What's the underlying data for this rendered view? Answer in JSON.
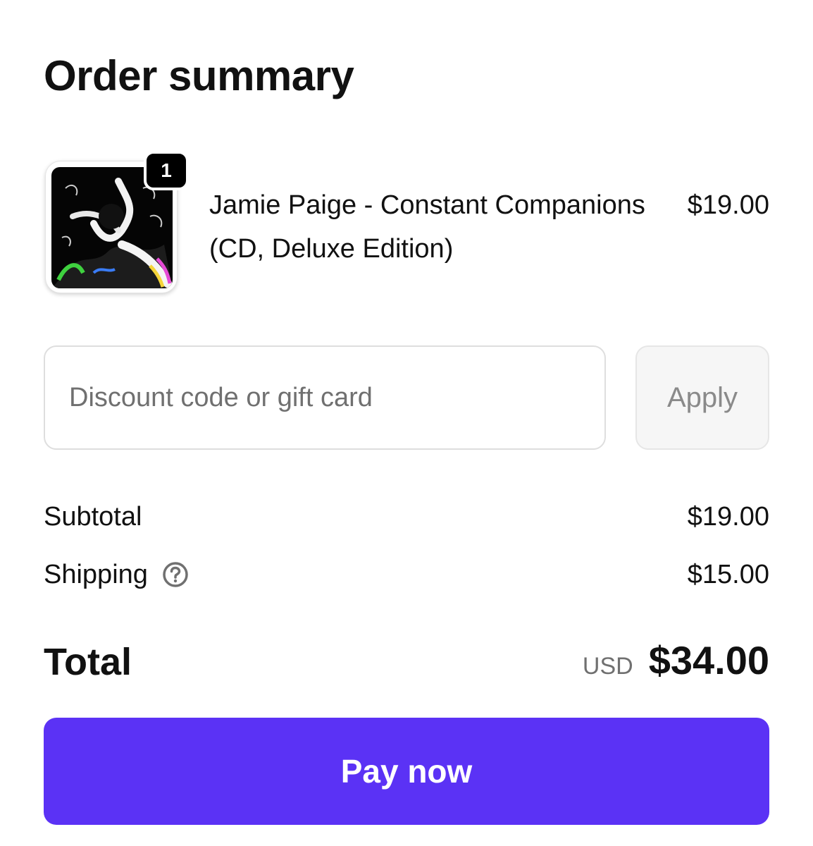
{
  "header": {
    "title": "Order summary"
  },
  "line_item": {
    "quantity": "1",
    "name": "Jamie Paige - Constant Companions (CD, Deluxe Edition)",
    "price": "$19.00",
    "image_alt": "album-cover-image"
  },
  "discount": {
    "placeholder": "Discount code or gift card",
    "value": "",
    "apply_label": "Apply"
  },
  "totals": {
    "subtotal_label": "Subtotal",
    "subtotal_value": "$19.00",
    "shipping_label": "Shipping",
    "shipping_value": "$15.00",
    "total_label": "Total",
    "currency": "USD",
    "total_value": "$34.00"
  },
  "actions": {
    "pay_label": "Pay now"
  },
  "colors": {
    "primary": "#5b32f5",
    "text": "#111111",
    "muted": "#707070"
  }
}
